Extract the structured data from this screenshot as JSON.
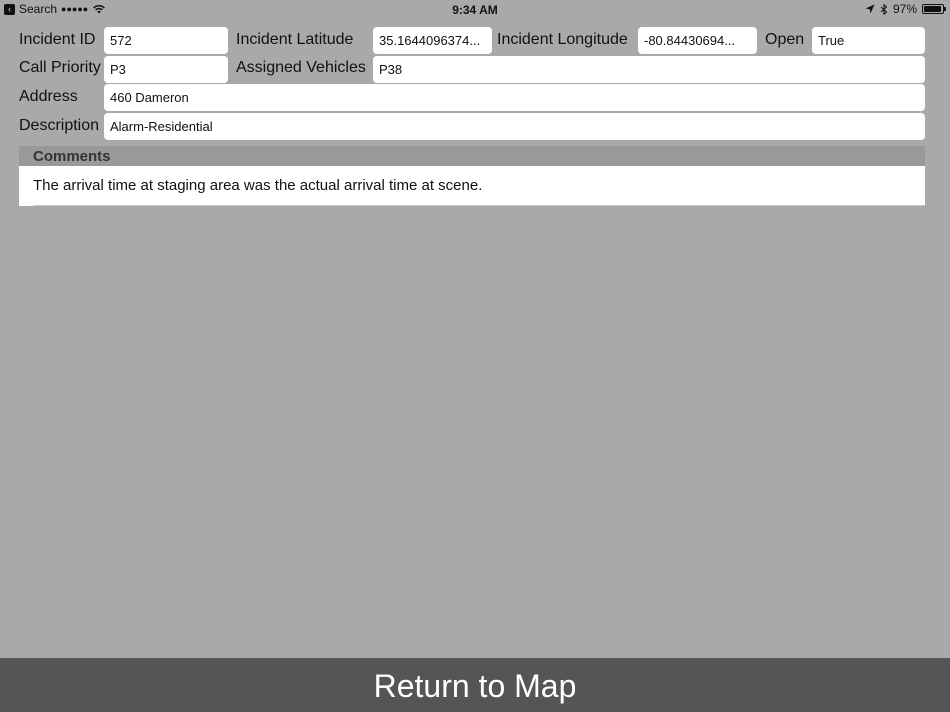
{
  "status_bar": {
    "back_label": "Search",
    "signal": "●●●●●",
    "time": "9:34 AM",
    "battery_percent": "97%",
    "battery_level": 0.97
  },
  "form": {
    "incident_id": {
      "label": "Incident ID",
      "value": "572"
    },
    "incident_latitude": {
      "label": "Incident Latitude",
      "value": "35.1644096374..."
    },
    "incident_longitude": {
      "label": "Incident Longitude",
      "value": "-80.84430694..."
    },
    "open": {
      "label": "Open",
      "value": "True"
    },
    "call_priority": {
      "label": "Call Priority",
      "value": "P3"
    },
    "assigned_vehicles": {
      "label": "Assigned Vehicles",
      "value": "P38"
    },
    "address": {
      "label": "Address",
      "value": "460 Dameron"
    },
    "description": {
      "label": "Description",
      "value": "Alarm-Residential"
    }
  },
  "comments": {
    "header": "Comments",
    "text": "The arrival time at staging area was the actual arrival time at scene."
  },
  "footer": {
    "return_label": "Return to Map"
  }
}
